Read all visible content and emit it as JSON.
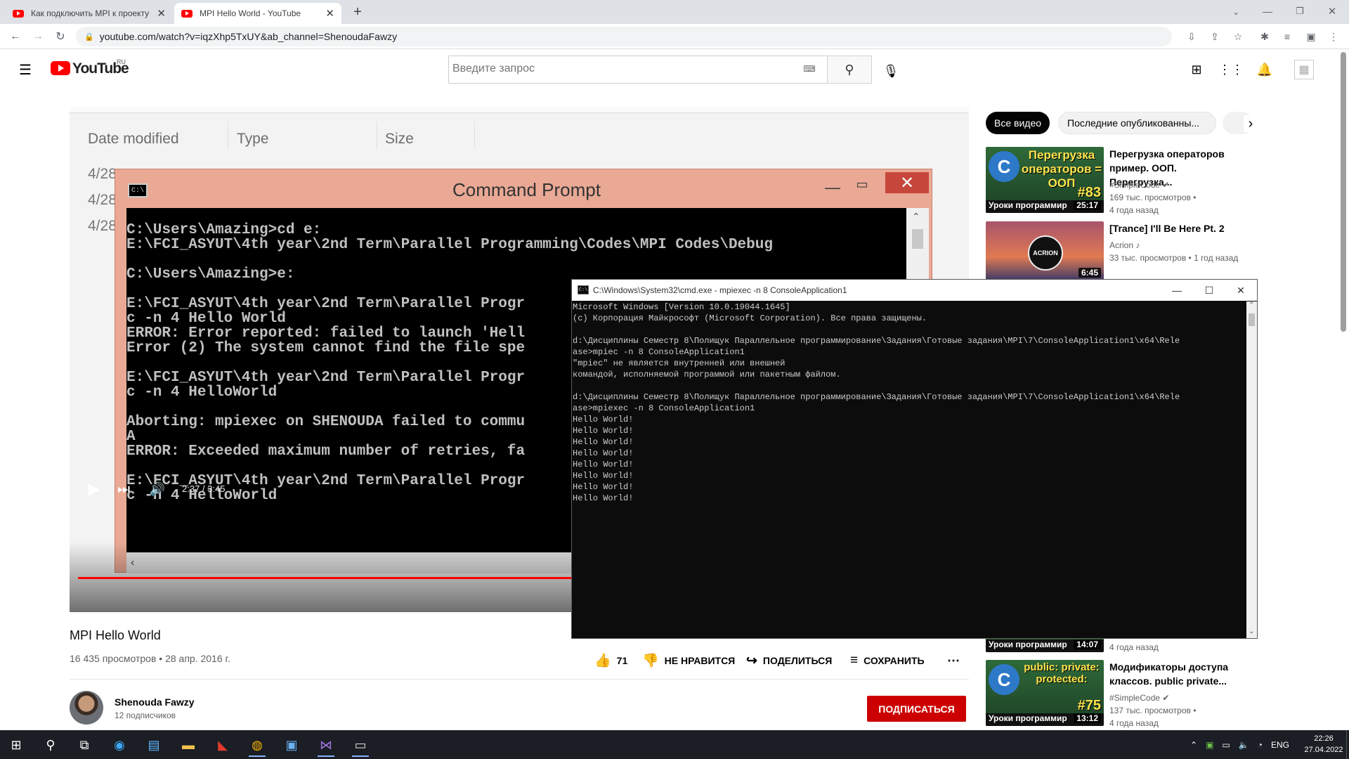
{
  "browser": {
    "tabs": [
      {
        "title": "Как подключить MPI к проекту",
        "active": false
      },
      {
        "title": "MPI Hello World - YouTube",
        "active": true
      }
    ],
    "new_tab": "+",
    "url": "youtube.com/watch?v=iqzXhp5TxUY&ab_channel=ShenoudaFawzy"
  },
  "youtube": {
    "logo": "YouTube",
    "region": "RU",
    "search_placeholder": "Введите запрос",
    "player": {
      "explorer_columns": [
        "Date modified",
        "Type",
        "Size"
      ],
      "explorer_dates": [
        "4/28",
        "4/28",
        "4/28"
      ],
      "window_title": "Command Prompt",
      "console_lines": [
        "C:\\Users\\Amazing>cd e:",
        "E:\\FCI_ASYUT\\4th year\\2nd Term\\Parallel Programming\\Codes\\MPI Codes\\Debug",
        "",
        "C:\\Users\\Amazing>e:",
        "",
        "E:\\FCI_ASYUT\\4th year\\2nd Term\\Parallel Progr",
        "c -n 4 Hello World",
        "ERROR: Error reported: failed to launch 'Hell",
        "Error (2) The system cannot find the file spe",
        "",
        "E:\\FCI_ASYUT\\4th year\\2nd Term\\Parallel Progr",
        "c -n 4 HelloWorld",
        "",
        "Aborting: mpiexec on SHENOUDA failed to commu",
        "A",
        "ERROR: Exceeded maximum number of retries, fa",
        "",
        "E:\\FCI_ASYUT\\4th year\\2nd Term\\Parallel Progr",
        "c -n 4 HelloWorld"
      ],
      "time": "2:37 / 3:45",
      "progress": 0.698
    },
    "video": {
      "title": "MPI Hello World",
      "meta": "16 435 просмотров • 28 апр. 2016 г.",
      "likes": "71",
      "dislike_label": "НЕ НРАВИТСЯ",
      "share_label": "ПОДЕЛИТЬСЯ",
      "save_label": "СОХРАНИТЬ",
      "more": "⋯"
    },
    "channel": {
      "name": "Shenouda Fawzy",
      "subscribers": "12 подписчиков",
      "subscribe_label": "ПОДПИСАТЬСЯ"
    },
    "sidebar": {
      "chips": [
        "Все видео",
        "Последние опубликованны..."
      ],
      "items": [
        {
          "title_lines": [
            "Перегрузка операторов",
            "пример. ООП. Перегрузка..."
          ],
          "channel": "#SimpleCode",
          "views": "169 тыс. просмотров •",
          "age": "4 года назад",
          "duration": "25:17",
          "thumb_text": "Перегрузка операторов = ООП",
          "thumb_num": "#83",
          "thumb_band": "Уроки программир"
        },
        {
          "title_lines": [
            "[Trance] I'll Be Here Pt. 2"
          ],
          "channel": "Acrion",
          "views": "33 тыс. просмотров • 1 год назад",
          "age": "",
          "duration": "6:45",
          "thumb_text": "ACRION"
        },
        {
          "age": "4 года назад",
          "duration": "14:07",
          "thumb_band": "Уроки программир"
        },
        {
          "title_lines": [
            "Модификаторы доступа",
            "классов. public private..."
          ],
          "channel": "#SimpleCode",
          "views": "137 тыс. просмотров •",
          "age": "4 года назад",
          "duration": "13:12",
          "thumb_text": "public: private: protected:",
          "thumb_num": "#75",
          "thumb_band": "Уроки программир"
        }
      ]
    }
  },
  "cmd": {
    "title": "C:\\Windows\\System32\\cmd.exe - mpiexec  -n 8 ConsoleApplication1",
    "lines": [
      "Microsoft Windows [Version 10.0.19044.1645]",
      "(c) Корпорация Майкрософт (Microsoft Corporation). Все права защищены.",
      "",
      "d:\\Дисциплины Семестр 8\\Полищук Параллельное программирование\\Задания\\Готовые задания\\MPI\\7\\ConsoleApplication1\\x64\\Rele",
      "ase>mpiec -n 8 ConsoleApplication1",
      "\"mpiec\" не является внутренней или внешней",
      "командой, исполняемой программой или пакетным файлом.",
      "",
      "d:\\Дисциплины Семестр 8\\Полищук Параллельное программирование\\Задания\\Готовые задания\\MPI\\7\\ConsoleApplication1\\x64\\Rele",
      "ase>mpiexec -n 8 ConsoleApplication1",
      "Hello World!",
      "Hello World!",
      "Hello World!",
      "Hello World!",
      "Hello World!",
      "Hello World!",
      "Hello World!",
      "Hello World!"
    ]
  },
  "taskbar": {
    "language": "ENG",
    "time": "22:26",
    "date": "27.04.2022"
  },
  "colors": {
    "youtube_red": "#ff0000",
    "subscribe_red": "#cc0000",
    "console_bg": "#0c0c0c",
    "taskbar_bg": "#1b1e25"
  }
}
